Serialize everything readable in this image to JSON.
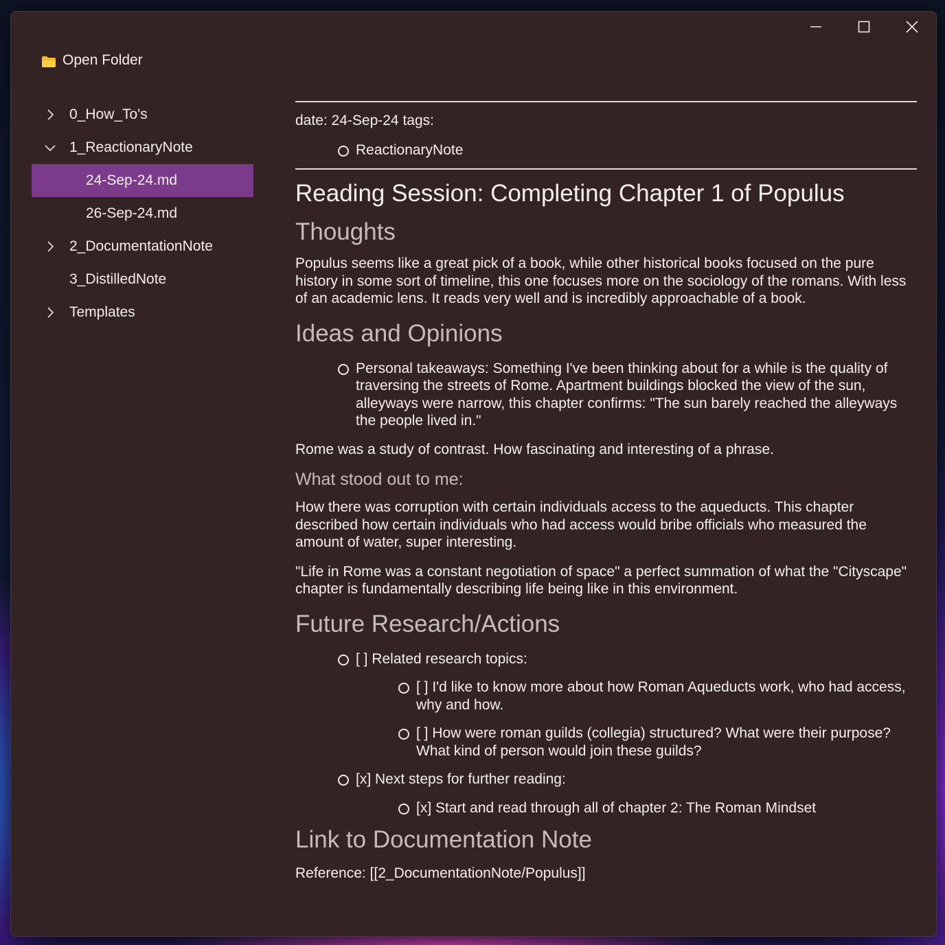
{
  "window": {
    "controls": {
      "minimize": "minimize-icon",
      "maximize": "maximize-icon",
      "close": "close-icon"
    }
  },
  "sidebar": {
    "open_folder_label": "Open Folder",
    "items": [
      {
        "label": "0_How_To's",
        "expanded": false,
        "has_children": true
      },
      {
        "label": "1_ReactionaryNote",
        "expanded": true,
        "has_children": true
      },
      {
        "label": "24-Sep-24.md",
        "selected": true
      },
      {
        "label": "26-Sep-24.md"
      },
      {
        "label": "2_DocumentationNote",
        "expanded": false,
        "has_children": true
      },
      {
        "label": "3_DistilledNote",
        "has_children": false
      },
      {
        "label": "Templates",
        "expanded": false,
        "has_children": true
      }
    ]
  },
  "note": {
    "frontmatter": {
      "date_line": "date: 24-Sep-24 tags:",
      "tag": "ReactionaryNote"
    },
    "title": "Reading Session: Completing Chapter 1 of Populus",
    "thoughts_heading": "Thoughts",
    "thoughts_text": "Populus seems like a great pick of a book, while other historical books focused on the pure history in some sort of timeline, this one focuses more on the sociology of the romans. With less of an academic lens. It reads very well and is incredibly approachable of a book.",
    "ideas_heading": "Ideas and Opinions",
    "ideas_bullet": "Personal takeaways: Something I've been thinking about for a while is the quality of traversing the streets of Rome. Apartment buildings blocked the view of the sun, alleyways were narrow, this chapter confirms: \"The sun barely reached the alleyways the people lived in.\"",
    "contrast_text": "Rome was a study of contrast. How fascinating and interesting of a phrase.",
    "stood_out_heading": "What stood out to me:",
    "stood_out_p1": "How there was corruption with certain individuals access to the aqueducts. This chapter described how certain individuals who had access would bribe officials who measured the amount of water, super interesting.",
    "stood_out_p2": "\"Life in Rome was a constant negotiation of space\" a perfect summation of what the \"Cityscape\" chapter is fundamentally describing life being like in this environment.",
    "future_heading": "Future Research/Actions",
    "future_item1": "[ ] Related research topics:",
    "future_item1_sub1": "[ ] I'd like to know more about how Roman Aqueducts work, who had access, why and how.",
    "future_item1_sub2": "[ ] How were roman guilds (collegia) structured? What were their purpose? What kind of person would join these guilds?",
    "future_item2": "[x] Next steps for further reading:",
    "future_item2_sub1": "[x] Start and read through all of chapter 2: The Roman Mindset",
    "link_heading": "Link to Documentation Note",
    "reference": "Reference: [[2_DocumentationNote/Populus]]"
  },
  "colors": {
    "window_bg": "#332324",
    "selected_bg": "#7b3a8a",
    "folder_icon": "#f5b82e",
    "heading_muted": "#c6bcbc"
  }
}
